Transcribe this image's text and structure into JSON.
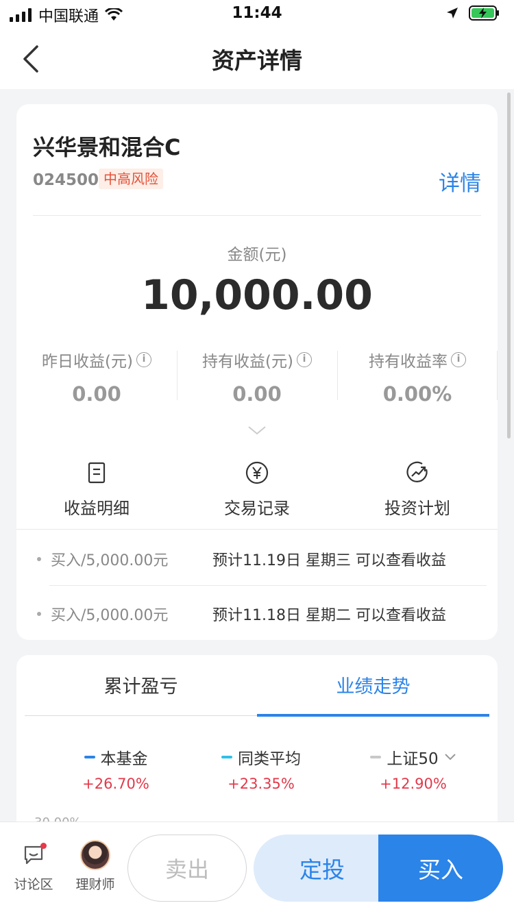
{
  "status_bar": {
    "carrier": "中国联通",
    "time": "11:44"
  },
  "nav": {
    "title": "资产详情"
  },
  "fund": {
    "name": "兴华景和混合C",
    "code": "024500",
    "risk": "中高风险",
    "detail_link": "详情"
  },
  "amount": {
    "label": "金额(元)",
    "value": "10,000.00"
  },
  "stats": [
    {
      "label": "昨日收益(元)",
      "value": "0.00"
    },
    {
      "label": "持有收益(元)",
      "value": "0.00"
    },
    {
      "label": "持有收益率",
      "value": "0.00%"
    }
  ],
  "actions": [
    {
      "label": "收益明细",
      "icon": "document-icon"
    },
    {
      "label": "交易记录",
      "icon": "yuan-icon"
    },
    {
      "label": "投资计划",
      "icon": "trend-icon"
    }
  ],
  "transactions": [
    {
      "left": "买入/5,000.00元",
      "right": "预计11.19日 星期三 可以查看收益"
    },
    {
      "left": "买入/5,000.00元",
      "right": "预计11.18日 星期二 可以查看收益"
    }
  ],
  "tabs": {
    "cumulative": "累计盈亏",
    "performance": "业绩走势",
    "active": "performance"
  },
  "legend": [
    {
      "name": "本基金",
      "value": "+26.70%",
      "color": "#2b84e8"
    },
    {
      "name": "同类平均",
      "value": "+23.35%",
      "color": "#2fc0e8"
    },
    {
      "name": "上证50",
      "value": "+12.90%",
      "color": "#c8c8c8"
    }
  ],
  "chart": {
    "top_tick": "30.00%"
  },
  "bottom_bar": {
    "discussion": "讨论区",
    "advisor": "理财师",
    "sell": "卖出",
    "sip": "定投",
    "buy": "买入"
  },
  "colors": {
    "accent": "#2b84e8",
    "positive": "#e3384a",
    "risk": "#e3523a"
  }
}
